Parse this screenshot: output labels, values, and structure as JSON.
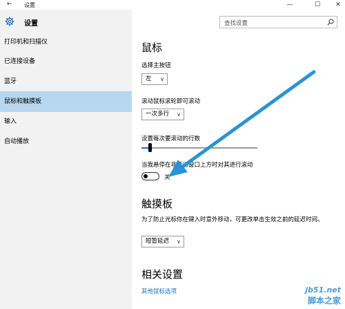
{
  "window": {
    "title": "设置",
    "back": "←",
    "minimize": "—",
    "maximize": "☐",
    "close": "✕"
  },
  "sidebar": {
    "app_title": "设置",
    "items": [
      {
        "label": "打印机和扫描仪"
      },
      {
        "label": "已连接设备"
      },
      {
        "label": "蓝牙"
      },
      {
        "label": "鼠标和触摸板"
      },
      {
        "label": "输入"
      },
      {
        "label": "自动播放"
      }
    ],
    "active_item": "鼠标和触摸板"
  },
  "search": {
    "placeholder": "查找设置"
  },
  "mouse": {
    "heading": "鼠标",
    "primary_button_label": "选择主按钮",
    "primary_button_value": "左",
    "wheel_label": "滚动鼠标滚轮即可滚动",
    "wheel_value": "一次多行",
    "lines_label": "设置每次要滚动的行数",
    "lines_level": 0.07,
    "inactive_scroll_label": "当我悬停在非活动窗口上方时对其进行滚动",
    "inactive_scroll_state": "关"
  },
  "touchpad": {
    "heading": "触摸板",
    "desc": "为了防止光标你在键入时意外移动，可更改单击生效之前的延迟时间。",
    "delay_value": "短暂延迟"
  },
  "related": {
    "heading": "相关设置",
    "link": "其他鼠标选项"
  },
  "watermark": {
    "site": "jb51.net",
    "brand": "脚本之家"
  },
  "colors": {
    "accent": "#1a6fc9",
    "active_nav": "#b8d7ef",
    "arrow": "#2a93d5"
  }
}
